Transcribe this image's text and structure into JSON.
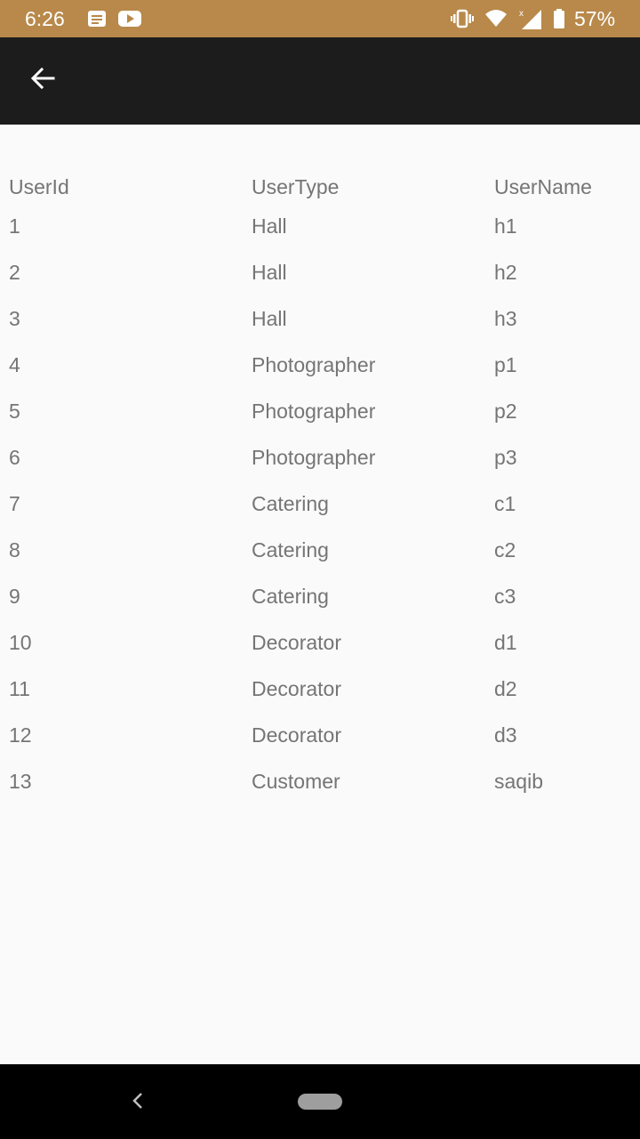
{
  "status_bar": {
    "time": "6:26",
    "battery_percent": "57%",
    "icons": [
      "message-icon",
      "youtube-icon",
      "vibrate-icon",
      "wifi-icon",
      "signal-icon",
      "battery-icon"
    ],
    "background_color": "#b8894a"
  },
  "app_bar": {
    "back_icon": "arrow-left-icon",
    "background_color": "#1c1c1c"
  },
  "table": {
    "headers": [
      "UserId",
      "UserType",
      "UserName"
    ],
    "rows": [
      [
        "1",
        "Hall",
        "h1"
      ],
      [
        "2",
        "Hall",
        "h2"
      ],
      [
        "3",
        "Hall",
        "h3"
      ],
      [
        "4",
        "Photographer",
        "p1"
      ],
      [
        "5",
        "Photographer",
        "p2"
      ],
      [
        "6",
        "Photographer",
        "p3"
      ],
      [
        "7",
        "Catering",
        "c1"
      ],
      [
        "8",
        "Catering",
        "c2"
      ],
      [
        "9",
        "Catering",
        "c3"
      ],
      [
        "10",
        "Decorator",
        "d1"
      ],
      [
        "11",
        "Decorator",
        "d2"
      ],
      [
        "12",
        "Decorator",
        "d3"
      ],
      [
        "13",
        "Customer",
        "saqib"
      ]
    ]
  },
  "nav_bar": {
    "back_icon": "chevron-left-icon",
    "home_icon": "home-pill-icon"
  }
}
